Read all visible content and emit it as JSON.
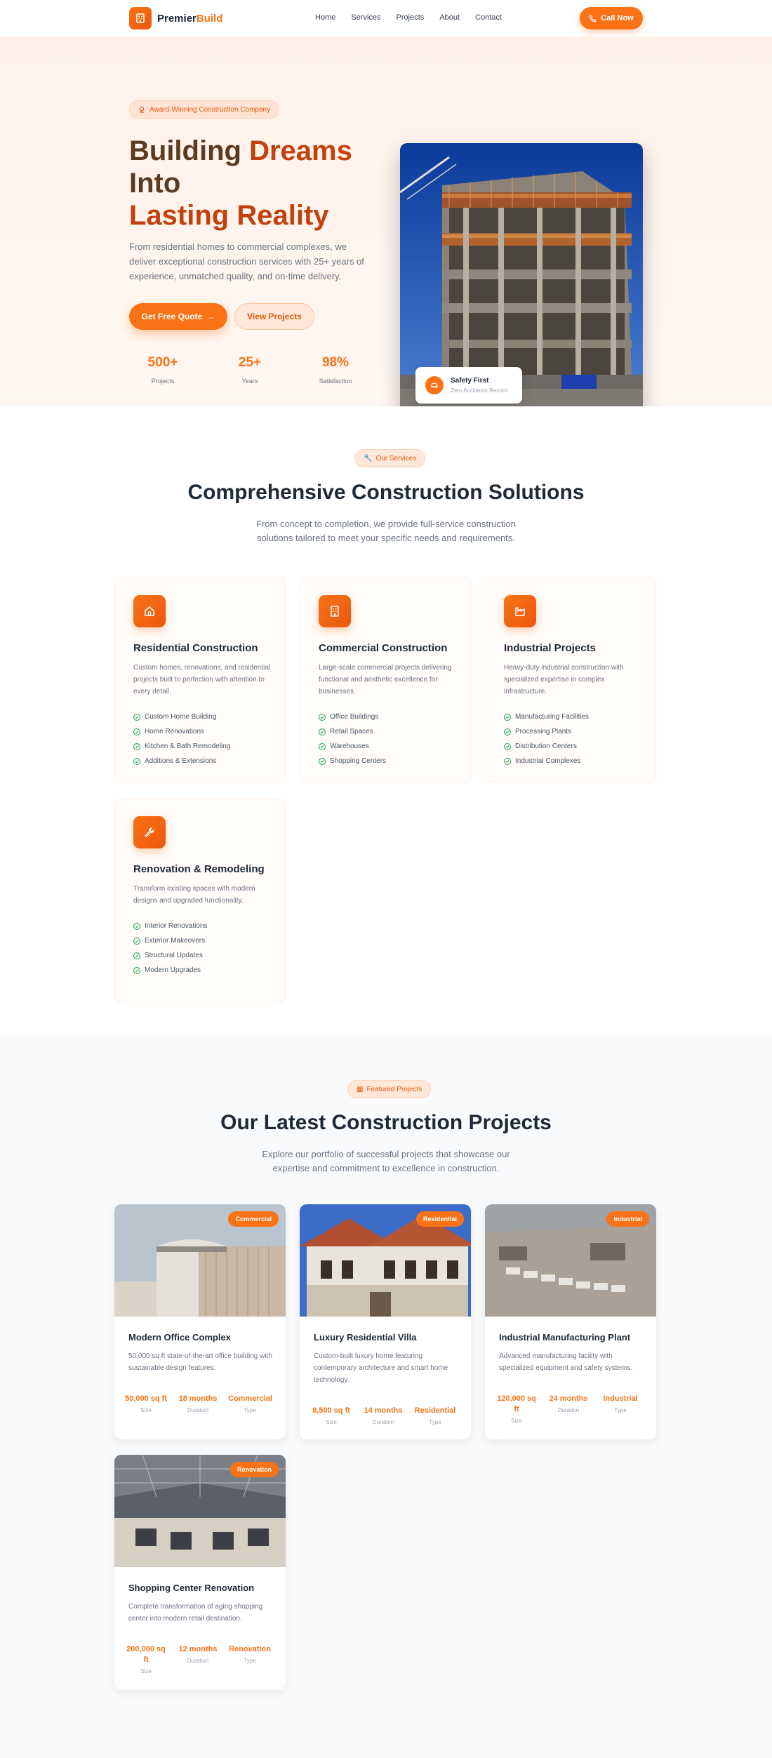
{
  "header": {
    "logo_main": "Premier",
    "logo_accent": "Build",
    "nav": [
      "Home",
      "Services",
      "Projects",
      "About",
      "Contact"
    ],
    "call_label": "Call Now"
  },
  "hero": {
    "badge": "Award-Winning Construction Company",
    "title_l1_a": "Building ",
    "title_l1_b": "Dreams",
    "title_l2": "Into",
    "title_l3_a": "Lasting ",
    "title_l3_b": "Reality",
    "description": "From residential homes to commercial complexes, we deliver exceptional construction services with 25+ years of experience, unmatched quality, and on-time delivery.",
    "primary_btn": "Get Free Quote",
    "secondary_btn": "View Projects",
    "stats": [
      {
        "value": "500+",
        "label": "Projects"
      },
      {
        "value": "25+",
        "label": "Years"
      },
      {
        "value": "98%",
        "label": "Satisfaction"
      }
    ],
    "safety_title": "Safety First",
    "safety_sub": "Zero Accidents Record"
  },
  "services": {
    "badge": "Our Services",
    "title": "Comprehensive Construction Solutions",
    "description": "From concept to completion, we provide full-service construction solutions tailored to meet your specific needs and requirements.",
    "cards": [
      {
        "icon": "home-icon",
        "title": "Residential Construction",
        "desc": "Custom homes, renovations, and residential projects built to perfection with attention to every detail.",
        "items": [
          "Custom Home Building",
          "Home Renovations",
          "Kitchen & Bath Remodeling",
          "Additions & Extensions"
        ]
      },
      {
        "icon": "building-icon",
        "title": "Commercial Construction",
        "desc": "Large-scale commercial projects delivering functional and aesthetic excellence for businesses.",
        "items": [
          "Office Buildings",
          "Retail Spaces",
          "Warehouses",
          "Shopping Centers"
        ]
      },
      {
        "icon": "factory-icon",
        "title": "Industrial Projects",
        "desc": "Heavy-duty industrial construction with specialized expertise in complex infrastructure.",
        "items": [
          "Manufacturing Facilities",
          "Processing Plants",
          "Distribution Centers",
          "Industrial Complexes"
        ]
      },
      {
        "icon": "wrench-icon",
        "title": "Renovation & Remodeling",
        "desc": "Transform existing spaces with modern designs and upgraded functionality.",
        "items": [
          "Interior Renovations",
          "Exterior Makeovers",
          "Structural Updates",
          "Modern Upgrades"
        ]
      }
    ]
  },
  "projects": {
    "badge": "Featured Projects",
    "title": "Our Latest Construction Projects",
    "description": "Explore our portfolio of successful projects that showcase our expertise and commitment to excellence in construction.",
    "cards": [
      {
        "tag": "Commercial",
        "title": "Modern Office Complex",
        "desc": "50,000 sq ft state-of-the-art office building with sustainable design features.",
        "size": "50,000 sq ft",
        "duration": "18 months",
        "type": "Commercial"
      },
      {
        "tag": "Residential",
        "title": "Luxury Residential Villa",
        "desc": "Custom-built luxury home featuring contemporary architecture and smart home technology.",
        "size": "8,500 sq ft",
        "duration": "14 months",
        "type": "Residential"
      },
      {
        "tag": "Industrial",
        "title": "Industrial Manufacturing Plant",
        "desc": "Advanced manufacturing facility with specialized equipment and safety systems.",
        "size": "120,000 sq ft",
        "duration": "24 months",
        "type": "Industrial"
      },
      {
        "tag": "Renovation",
        "title": "Shopping Center Renovation",
        "desc": "Complete transformation of aging shopping center into modern retail destination.",
        "size": "200,000 sq ft",
        "duration": "12 months",
        "type": "Renovation"
      }
    ],
    "labels": {
      "size": "Size",
      "duration": "Duration",
      "type": "Type"
    }
  },
  "colors": {
    "accent": "#f97316",
    "accent_dark": "#ea580c",
    "heading": "#1f2937",
    "check": "#16a34a"
  }
}
